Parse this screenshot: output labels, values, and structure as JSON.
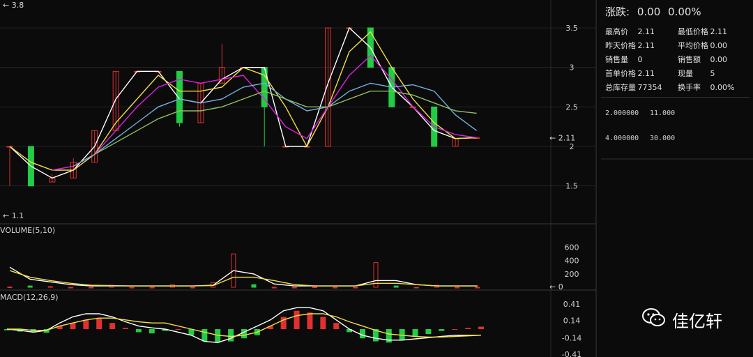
{
  "info": {
    "change_label": "涨跌:",
    "change_value": "0.00",
    "change_pct": "0.00%",
    "rows": [
      {
        "k1": "最高价",
        "v1": "2.11",
        "k2": "最低价格",
        "v2": "2.11"
      },
      {
        "k1": "昨天价格",
        "v1": "2.11",
        "k2": "平均价格",
        "v2": "0.00"
      },
      {
        "k1": "销售量",
        "v1": "0",
        "k2": "销售额",
        "v2": "0.00"
      },
      {
        "k1": "首单价格",
        "v1": "2.11",
        "k2": "现量",
        "v2": "5"
      },
      {
        "k1": "总库存量",
        "v1": "77354",
        "k2": "换手率",
        "v2": "0.00%"
      }
    ],
    "ma_rows": [
      {
        "a": "2.000000",
        "b": "11.000"
      },
      {
        "a": "4.000000",
        "b": "30.000"
      }
    ]
  },
  "watermark": {
    "text": "佳亿轩",
    "icon": "wechat-icon"
  },
  "colors": {
    "up": "#e03030",
    "down": "#22cc44",
    "ma1": "#ffffff",
    "ma2": "#f0e040",
    "ma3": "#e020e0",
    "ma4": "#70b0e0",
    "ma5": "#90c060",
    "grid": "#2a2a2a"
  },
  "chart_data": [
    {
      "type": "candlestick",
      "ylim": [
        1.1,
        3.8
      ],
      "yticks": [
        "3.5",
        "3",
        "2.5",
        "2",
        "1.5"
      ],
      "max_label": "3.8",
      "min_label": "1.1",
      "current_label": "2.11",
      "candles": [
        [
          2.0,
          2.0,
          1.5,
          2.0
        ],
        [
          2.0,
          1.5,
          1.5,
          2.0
        ],
        [
          1.55,
          1.6,
          1.55,
          1.65
        ],
        [
          1.6,
          1.8,
          1.6,
          1.85
        ],
        [
          1.8,
          2.2,
          1.8,
          2.2
        ],
        [
          2.2,
          2.95,
          2.2,
          2.95
        ],
        [
          2.95,
          2.95,
          2.95,
          2.95
        ],
        [
          2.95,
          2.95,
          2.95,
          2.95
        ],
        [
          2.95,
          2.3,
          2.25,
          2.95
        ],
        [
          2.3,
          2.8,
          2.3,
          2.8
        ],
        [
          2.8,
          3.0,
          2.8,
          3.3
        ],
        [
          3.0,
          3.0,
          3.0,
          3.0
        ],
        [
          3.0,
          2.5,
          2.0,
          3.0
        ],
        [
          2.0,
          2.0,
          2.0,
          2.0
        ],
        [
          2.0,
          2.0,
          2.0,
          2.0
        ],
        [
          2.0,
          3.5,
          2.0,
          3.5
        ],
        [
          3.5,
          3.5,
          3.5,
          3.5
        ],
        [
          3.5,
          3.0,
          3.0,
          3.5
        ],
        [
          3.0,
          2.5,
          2.5,
          3.0
        ],
        [
          2.5,
          2.5,
          2.5,
          2.5
        ],
        [
          2.5,
          2.0,
          2.0,
          2.5
        ],
        [
          2.0,
          2.1,
          2.0,
          2.1
        ],
        [
          2.11,
          2.11,
          2.11,
          2.11
        ]
      ],
      "ma_lines": [
        {
          "color": "ma1",
          "values": [
            2.0,
            1.75,
            1.6,
            1.7,
            2.0,
            2.6,
            2.95,
            2.95,
            2.6,
            2.55,
            2.85,
            3.0,
            3.0,
            2.0,
            2.0,
            2.8,
            3.5,
            3.25,
            2.75,
            2.5,
            2.2,
            2.1,
            2.11
          ]
        },
        {
          "color": "ma2",
          "values": [
            2.0,
            1.8,
            1.7,
            1.7,
            1.9,
            2.3,
            2.6,
            2.9,
            2.7,
            2.7,
            2.75,
            3.0,
            2.9,
            2.5,
            2.0,
            2.5,
            3.2,
            3.45,
            3.0,
            2.6,
            2.3,
            2.1,
            2.11
          ]
        },
        {
          "color": "ma3",
          "values": [
            null,
            null,
            1.7,
            1.75,
            1.9,
            2.2,
            2.5,
            2.75,
            2.85,
            2.8,
            2.85,
            2.9,
            2.6,
            2.25,
            2.1,
            2.5,
            2.9,
            3.15,
            2.85,
            2.5,
            2.25,
            2.15,
            2.11
          ]
        },
        {
          "color": "ma4",
          "values": [
            null,
            null,
            null,
            1.75,
            1.9,
            2.1,
            2.3,
            2.5,
            2.6,
            2.55,
            2.6,
            2.75,
            2.8,
            2.6,
            2.45,
            2.5,
            2.7,
            2.8,
            2.75,
            2.78,
            2.7,
            2.4,
            2.2
          ]
        },
        {
          "color": "ma5",
          "values": [
            null,
            null,
            null,
            null,
            1.9,
            2.05,
            2.2,
            2.35,
            2.45,
            2.45,
            2.5,
            2.6,
            2.7,
            2.6,
            2.5,
            2.5,
            2.6,
            2.7,
            2.7,
            2.65,
            2.55,
            2.45,
            2.42
          ]
        }
      ]
    },
    {
      "type": "bar",
      "title": "VOLUME(5,10)",
      "ylim": [
        0,
        700
      ],
      "yticks": [
        "600",
        "400",
        "200"
      ],
      "current_label": "0",
      "values": [
        5,
        20,
        10,
        0,
        0,
        30,
        0,
        0,
        40,
        0,
        70,
        500,
        40,
        0,
        0,
        5,
        0,
        0,
        370,
        20,
        0,
        30,
        0,
        0
      ],
      "dirs": [
        "u",
        "d",
        "u",
        "u",
        "u",
        "u",
        "u",
        "u",
        "u",
        "u",
        "u",
        "u",
        "d",
        "u",
        "u",
        "u",
        "u",
        "u",
        "u",
        "d",
        "u",
        "u",
        "u",
        "u"
      ],
      "ma_lines": [
        {
          "color": "ma1",
          "values": [
            300,
            120,
            80,
            40,
            20,
            20,
            20,
            20,
            20,
            20,
            30,
            250,
            200,
            50,
            20,
            20,
            20,
            20,
            100,
            100,
            40,
            20,
            20,
            20
          ]
        },
        {
          "color": "ma2",
          "values": [
            250,
            150,
            100,
            60,
            30,
            25,
            20,
            20,
            20,
            20,
            25,
            150,
            150,
            100,
            40,
            20,
            20,
            20,
            60,
            60,
            40,
            20,
            20,
            20
          ]
        }
      ]
    },
    {
      "type": "bar",
      "title": "MACD(12,26,9)",
      "ylim": [
        -0.41,
        0.41
      ],
      "yticks": [
        "0.41",
        "0.14",
        "-0.14",
        "-0.41"
      ],
      "values": [
        -0.02,
        -0.04,
        -0.05,
        -0.06,
        0.05,
        0.1,
        0.15,
        0.17,
        0.1,
        0.02,
        -0.05,
        -0.07,
        -0.03,
        0.0,
        -0.1,
        -0.2,
        -0.22,
        -0.2,
        -0.15,
        -0.1,
        0.05,
        0.2,
        0.3,
        0.27,
        0.2,
        0.1,
        -0.05,
        -0.15,
        -0.2,
        -0.22,
        -0.18,
        -0.12,
        -0.08,
        -0.03,
        0.0,
        0.02,
        0.04
      ],
      "ma_lines": [
        {
          "color": "ma1",
          "values": [
            0.0,
            -0.02,
            -0.05,
            -0.02,
            0.1,
            0.2,
            0.25,
            0.25,
            0.2,
            0.12,
            0.05,
            0.02,
            0.0,
            -0.05,
            -0.1,
            -0.2,
            -0.22,
            -0.15,
            -0.05,
            0.05,
            0.15,
            0.3,
            0.35,
            0.35,
            0.3,
            0.15,
            0.0,
            -0.1,
            -0.15,
            -0.18,
            -0.18,
            -0.16,
            -0.14,
            -0.12,
            -0.1,
            -0.1,
            -0.1
          ]
        },
        {
          "color": "ma2",
          "values": [
            0.0,
            0.0,
            -0.02,
            -0.02,
            0.05,
            0.1,
            0.15,
            0.18,
            0.18,
            0.15,
            0.12,
            0.1,
            0.1,
            0.05,
            0.0,
            -0.05,
            -0.1,
            -0.12,
            -0.1,
            -0.05,
            0.05,
            0.15,
            0.22,
            0.25,
            0.25,
            0.2,
            0.12,
            0.05,
            -0.02,
            -0.08,
            -0.1,
            -0.12,
            -0.13,
            -0.13,
            -0.12,
            -0.11,
            -0.1
          ]
        }
      ]
    }
  ]
}
